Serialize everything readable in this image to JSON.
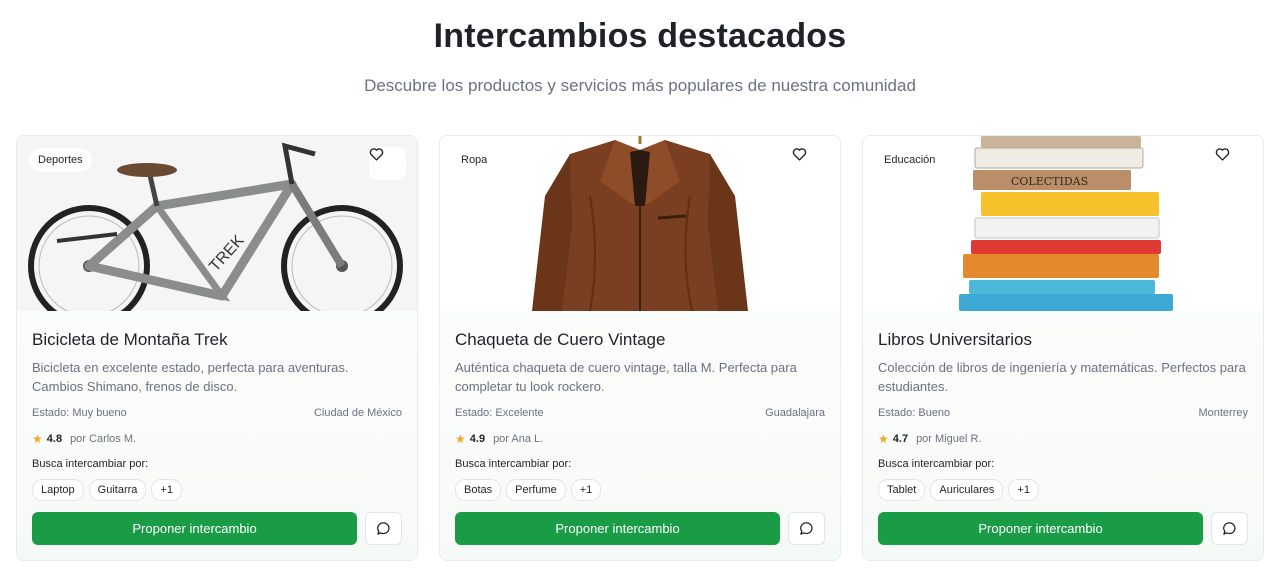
{
  "header": {
    "title": "Intercambios destacados",
    "subtitle": "Descubre los productos y servicios más populares de nuestra comunidad"
  },
  "colors": {
    "primary": "#1a9c47",
    "star": "#f5a623",
    "muted_text": "#6b7280"
  },
  "labels": {
    "seeking": "Busca intercambiar por:",
    "propose": "Proponer intercambio"
  },
  "icons": {
    "favorite": "heart-icon",
    "message": "chat-bubble-icon",
    "rating": "star-icon"
  },
  "cards": [
    {
      "category": "Deportes",
      "image": "mountain-bike",
      "name": "Bicicleta de Montaña Trek",
      "description": "Bicicleta en excelente estado, perfecta para aventuras. Cambios Shimano, frenos de disco.",
      "condition": "Estado: Muy bueno",
      "location": "Ciudad de México",
      "rating": "4.8",
      "owner": "por Carlos M.",
      "wants": [
        "Laptop",
        "Guitarra",
        "+1"
      ]
    },
    {
      "category": "Ropa",
      "image": "leather-jacket",
      "name": "Chaqueta de Cuero Vintage",
      "description": "Auténtica chaqueta de cuero vintage, talla M. Perfecta para completar tu look rockero.",
      "condition": "Estado: Excelente",
      "location": "Guadalajara",
      "rating": "4.9",
      "owner": "por Ana L.",
      "wants": [
        "Botas",
        "Perfume",
        "+1"
      ]
    },
    {
      "category": "Educación",
      "image": "book-stack",
      "name": "Libros Universitarios",
      "description": "Colección de libros de ingeniería y matemáticas. Perfectos para estudiantes.",
      "condition": "Estado: Bueno",
      "location": "Monterrey",
      "rating": "4.7",
      "owner": "por Miguel R.",
      "wants": [
        "Tablet",
        "Auriculares",
        "+1"
      ]
    }
  ]
}
